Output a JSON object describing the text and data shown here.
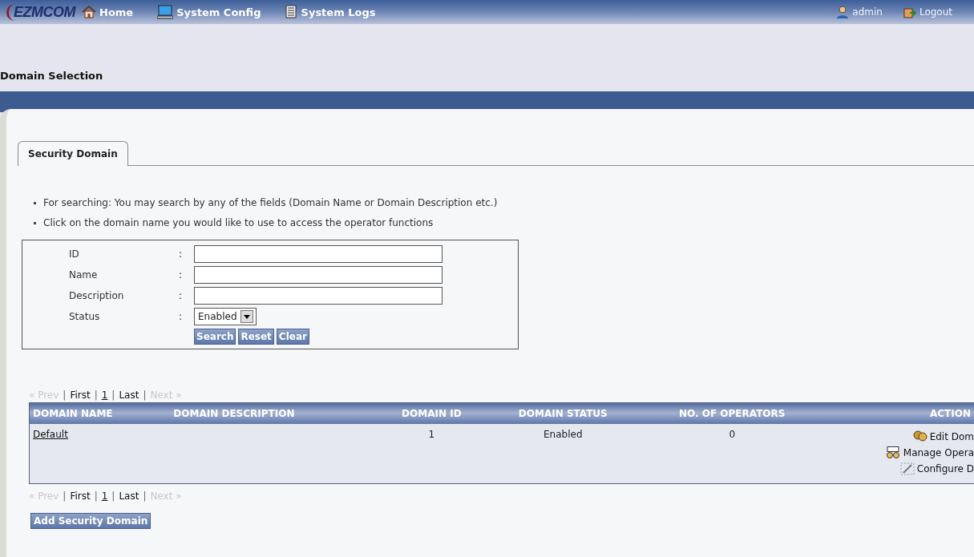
{
  "topbar": {
    "logo": "EZMCOM",
    "nav": [
      {
        "label": "Home",
        "kind": "home"
      },
      {
        "label": "System Config",
        "kind": "config"
      },
      {
        "label": "System Logs",
        "kind": "logs"
      }
    ],
    "user": "admin",
    "logout": "Logout"
  },
  "page_title": "Domain Selection",
  "tabs": [
    {
      "label": "Security Domain",
      "selected": true
    }
  ],
  "instructions": [
    "For searching: You may search by any of the fields (Domain Name or Domain Description etc.)",
    "Click on the domain name you would like to use to access the operator functions"
  ],
  "search_form": {
    "fields": [
      {
        "label": "ID",
        "colon": ":",
        "kind": "text"
      },
      {
        "label": "Name",
        "colon": ":",
        "kind": "text"
      },
      {
        "label": "Description",
        "colon": ":",
        "kind": "text"
      },
      {
        "label": "Status",
        "colon": ":",
        "kind": "select",
        "value": "Enabled"
      }
    ],
    "buttons": [
      "Search",
      "Reset",
      "Clear"
    ]
  },
  "pager_top": [
    {
      "kind": "link",
      "label": "« Prev",
      "disabled": true,
      "current": false
    },
    {
      "kind": "separator",
      "label": "|"
    },
    {
      "kind": "link",
      "label": "First",
      "disabled": false,
      "current": false
    },
    {
      "kind": "separator",
      "label": "|"
    },
    {
      "kind": "link",
      "label": "1",
      "disabled": false,
      "current": true
    },
    {
      "kind": "separator",
      "label": "|"
    },
    {
      "kind": "link",
      "label": "Last",
      "disabled": false,
      "current": false
    },
    {
      "kind": "separator",
      "label": "|"
    },
    {
      "kind": "link",
      "label": "Next »",
      "disabled": true,
      "current": false
    }
  ],
  "table": {
    "columns": [
      "DOMAIN NAME",
      "DOMAIN DESCRIPTION",
      "DOMAIN ID",
      "DOMAIN STATUS",
      "NO. OF OPERATORS",
      "ACTION"
    ],
    "rows": [
      {
        "name": "Default",
        "id": "1",
        "status": "Enabled",
        "operators": "0",
        "actions": [
          {
            "label": "Edit Dom",
            "kind": "edit"
          },
          {
            "label": "Manage Opera",
            "kind": "operators"
          },
          {
            "label": "Configure D",
            "kind": "configure"
          }
        ]
      }
    ]
  },
  "pager_bottom": [
    {
      "kind": "link",
      "label": "« Prev",
      "disabled": true,
      "current": false
    },
    {
      "kind": "separator",
      "label": "|"
    },
    {
      "kind": "link",
      "label": "First",
      "disabled": false,
      "current": false
    },
    {
      "kind": "separator",
      "label": "|"
    },
    {
      "kind": "link",
      "label": "1",
      "disabled": false,
      "current": true
    },
    {
      "kind": "separator",
      "label": "|"
    },
    {
      "kind": "link",
      "label": "Last",
      "disabled": false,
      "current": false
    },
    {
      "kind": "separator",
      "label": "|"
    },
    {
      "kind": "link",
      "label": "Next »",
      "disabled": true,
      "current": false
    }
  ],
  "add_button": "Add Security Domain"
}
